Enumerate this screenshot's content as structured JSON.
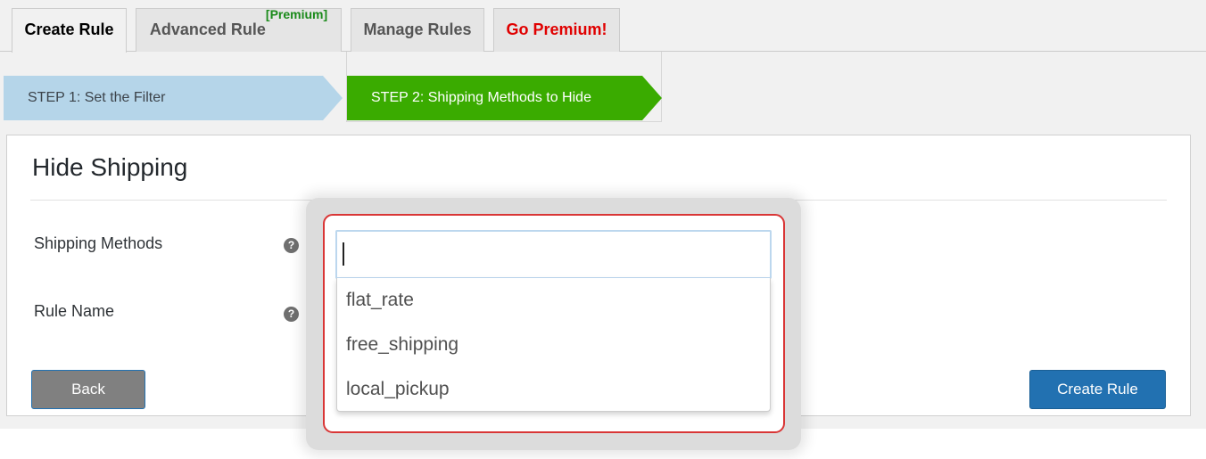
{
  "tabs": [
    {
      "label": "Create Rule",
      "sup": ""
    },
    {
      "label": "Advanced Rule",
      "sup": "[Premium]"
    },
    {
      "label": "Manage Rules",
      "sup": ""
    },
    {
      "label": "Go Premium!",
      "sup": ""
    }
  ],
  "steps": [
    {
      "label": "STEP 1: Set the Filter",
      "color": "#b5d5e9"
    },
    {
      "label": "STEP 2: Shipping Methods to Hide",
      "color": "#3aab00"
    }
  ],
  "panel": {
    "title": "Hide Shipping",
    "fields": [
      {
        "label": "Shipping Methods",
        "help": "?"
      },
      {
        "label": "Rule Name",
        "help": "?"
      }
    ],
    "back_label": "Back",
    "create_label": "Create Rule"
  },
  "dropdown": {
    "search_value": "",
    "options": [
      "flat_rate",
      "free_shipping",
      "local_pickup"
    ]
  },
  "colors": {
    "accent": "#2271b1",
    "premium": "#e00000",
    "highlight": "#d93636"
  }
}
